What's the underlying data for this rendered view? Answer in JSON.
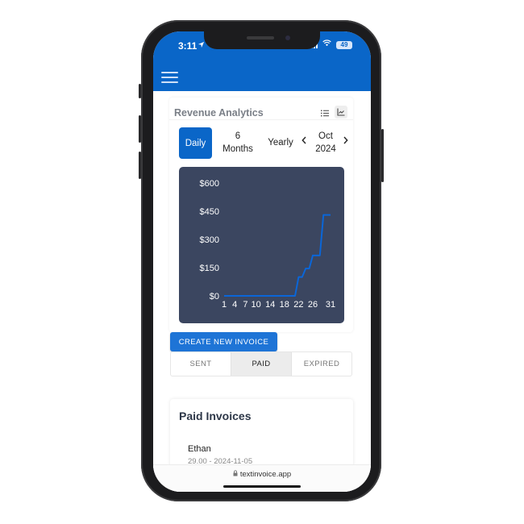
{
  "status_bar": {
    "time": "3:11",
    "battery": "49",
    "icons": [
      "location-arrow-icon",
      "signal-icon",
      "wifi-icon",
      "battery-icon"
    ]
  },
  "app_bar": {
    "menu_icon": "hamburger-menu-icon"
  },
  "revenue_card": {
    "title": "Revenue Analytics",
    "view_toggle": {
      "list_icon": "list-icon",
      "chart_icon": "line-chart-icon",
      "active": "chart"
    },
    "periods": [
      {
        "label": "Daily",
        "active": true
      },
      {
        "label_line1": "6",
        "label_line2": "Months",
        "active": false
      },
      {
        "label": "Yearly",
        "active": false
      }
    ],
    "month_nav": {
      "prev_icon": "chevron-left-icon",
      "month": "Oct",
      "year": "2024",
      "next_icon": "chevron-right-icon"
    }
  },
  "chart_data": {
    "type": "line",
    "title": "",
    "xlabel": "",
    "ylabel": "",
    "x": [
      1,
      2,
      3,
      4,
      5,
      6,
      7,
      8,
      9,
      10,
      11,
      12,
      13,
      14,
      15,
      16,
      17,
      18,
      19,
      20,
      21,
      22,
      23,
      24,
      25,
      26,
      27,
      28,
      29,
      30,
      31
    ],
    "series": [
      {
        "name": "Revenue",
        "color": "#0a66d8",
        "values": [
          0,
          0,
          0,
          0,
          0,
          0,
          0,
          0,
          0,
          0,
          0,
          0,
          0,
          0,
          0,
          0,
          0,
          0,
          0,
          0,
          0,
          100,
          100,
          145,
          145,
          215,
          215,
          215,
          430,
          430,
          430
        ]
      }
    ],
    "x_tick_labels": [
      "1",
      "4",
      "7",
      "10",
      "14",
      "18",
      "22",
      "26",
      "31"
    ],
    "y_ticks": [
      0,
      150,
      300,
      450,
      600
    ],
    "y_tick_labels": [
      "$0",
      "$150",
      "$300",
      "$450",
      "$600"
    ],
    "ylim": [
      0,
      600
    ],
    "xlim": [
      1,
      31
    ],
    "grid": false,
    "legend": "none",
    "background": "#3b4660",
    "tick_color": "#ffffff"
  },
  "actions": {
    "create_invoice": "CREATE NEW INVOICE"
  },
  "invoice_tabs": [
    {
      "label": "SENT",
      "active": false
    },
    {
      "label": "PAID",
      "active": true
    },
    {
      "label": "EXPIRED",
      "active": false
    }
  ],
  "paid_invoices": {
    "title": "Paid Invoices",
    "items": [
      {
        "name": "Ethan",
        "detail": "29.00 - 2024-11-05"
      }
    ]
  },
  "browser": {
    "url": "textinvoice.app",
    "lock_icon": "lock-icon"
  }
}
